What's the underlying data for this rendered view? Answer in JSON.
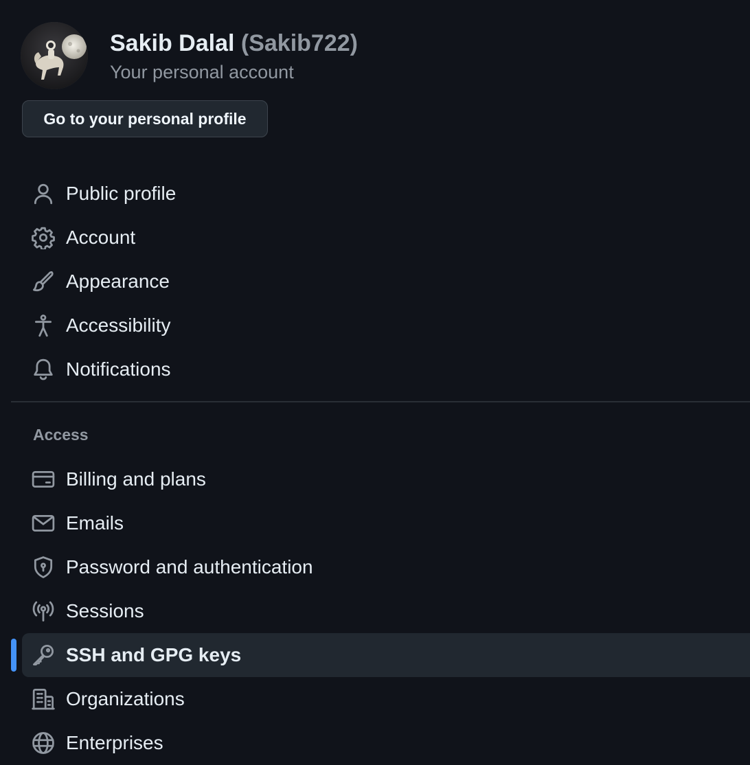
{
  "account": {
    "display_name": "Sakib Dalal",
    "username": "(Sakib722)",
    "subtitle": "Your personal account",
    "profile_button_label": "Go to your personal profile"
  },
  "nav": {
    "items": [
      {
        "label": "Public profile",
        "icon": "person-icon"
      },
      {
        "label": "Account",
        "icon": "gear-icon"
      },
      {
        "label": "Appearance",
        "icon": "paintbrush-icon"
      },
      {
        "label": "Accessibility",
        "icon": "accessibility-icon"
      },
      {
        "label": "Notifications",
        "icon": "bell-icon"
      }
    ],
    "access_heading": "Access",
    "access_items": [
      {
        "label": "Billing and plans",
        "icon": "credit-card-icon"
      },
      {
        "label": "Emails",
        "icon": "mail-icon"
      },
      {
        "label": "Password and authentication",
        "icon": "shield-lock-icon"
      },
      {
        "label": "Sessions",
        "icon": "broadcast-icon"
      },
      {
        "label": "SSH and GPG keys",
        "icon": "key-icon",
        "active": true
      },
      {
        "label": "Organizations",
        "icon": "organization-icon"
      },
      {
        "label": "Enterprises",
        "icon": "globe-icon"
      }
    ]
  },
  "colors": {
    "background": "#10131a",
    "active_item_background": "#212830",
    "active_indicator": "#4493f8",
    "muted_text": "#9198a1"
  }
}
